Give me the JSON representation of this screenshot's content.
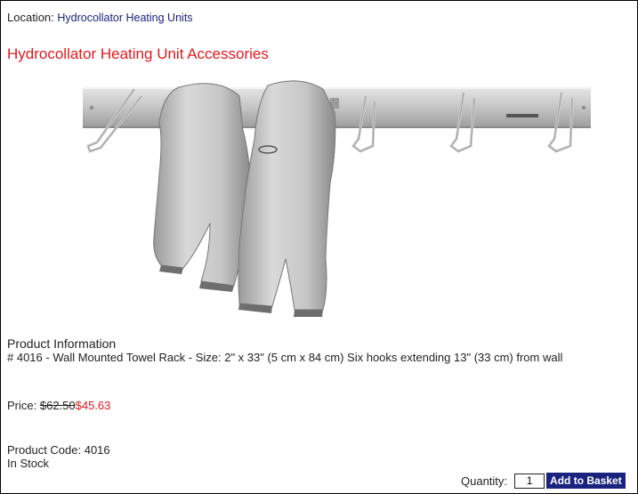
{
  "location": {
    "label": "Location:",
    "link": "Hydrocollator Heating Units"
  },
  "title": "Hydrocollator Heating Unit Accessories",
  "product": {
    "info_title": "Product Information",
    "description": "# 4016 - Wall Mounted Towel Rack - Size: 2\" x 33\" (5 cm x 84 cm) Six hooks extending 13\" (33 cm) from wall",
    "price_label": "Price:",
    "old_price": "$62.50",
    "new_price": "$45.63",
    "code_label": "Product Code: 4016",
    "stock": "In Stock"
  },
  "cart": {
    "quantity_label": "Quantity:",
    "quantity_value": "1",
    "add_label": "Add to Basket"
  },
  "colors": {
    "title": "#e0191f",
    "link": "#1a237e",
    "button": "#1a237e",
    "border": "#000000"
  }
}
